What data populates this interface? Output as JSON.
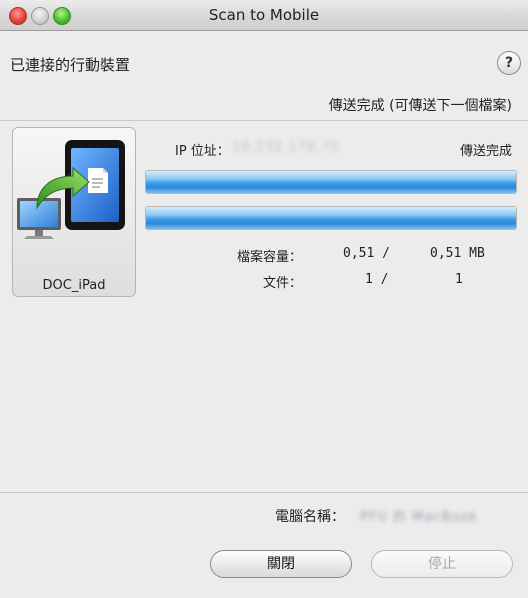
{
  "window": {
    "title": "Scan to Mobile"
  },
  "header": {
    "connected_devices_label": "已連接的行動裝置",
    "help_label": "?",
    "status_text": "傳送完成 (可傳送下一個檔案)"
  },
  "device": {
    "name": "DOC_iPad",
    "icon": "computer-to-tablet-transfer-icon"
  },
  "transfer": {
    "ip_label": "IP 位址：",
    "ip_value": "10.232.178.75",
    "status": "傳送完成",
    "progress_1": 1.0,
    "progress_2": 1.0,
    "file_size_label": "檔案容量：",
    "file_size_sent": "0,51 /",
    "file_size_total": "0,51 MB",
    "files_label": "文件：",
    "files_sent": "1 /",
    "files_total": "1"
  },
  "footer": {
    "computer_name_label": "電腦名稱：",
    "computer_name_value": "PFU 的 MacBook",
    "close_button": "關閉",
    "stop_button": "停止"
  },
  "colors": {
    "progress_blue": "#2b87da",
    "close_light": "#e2443a",
    "max_light": "#4bbf2d"
  }
}
